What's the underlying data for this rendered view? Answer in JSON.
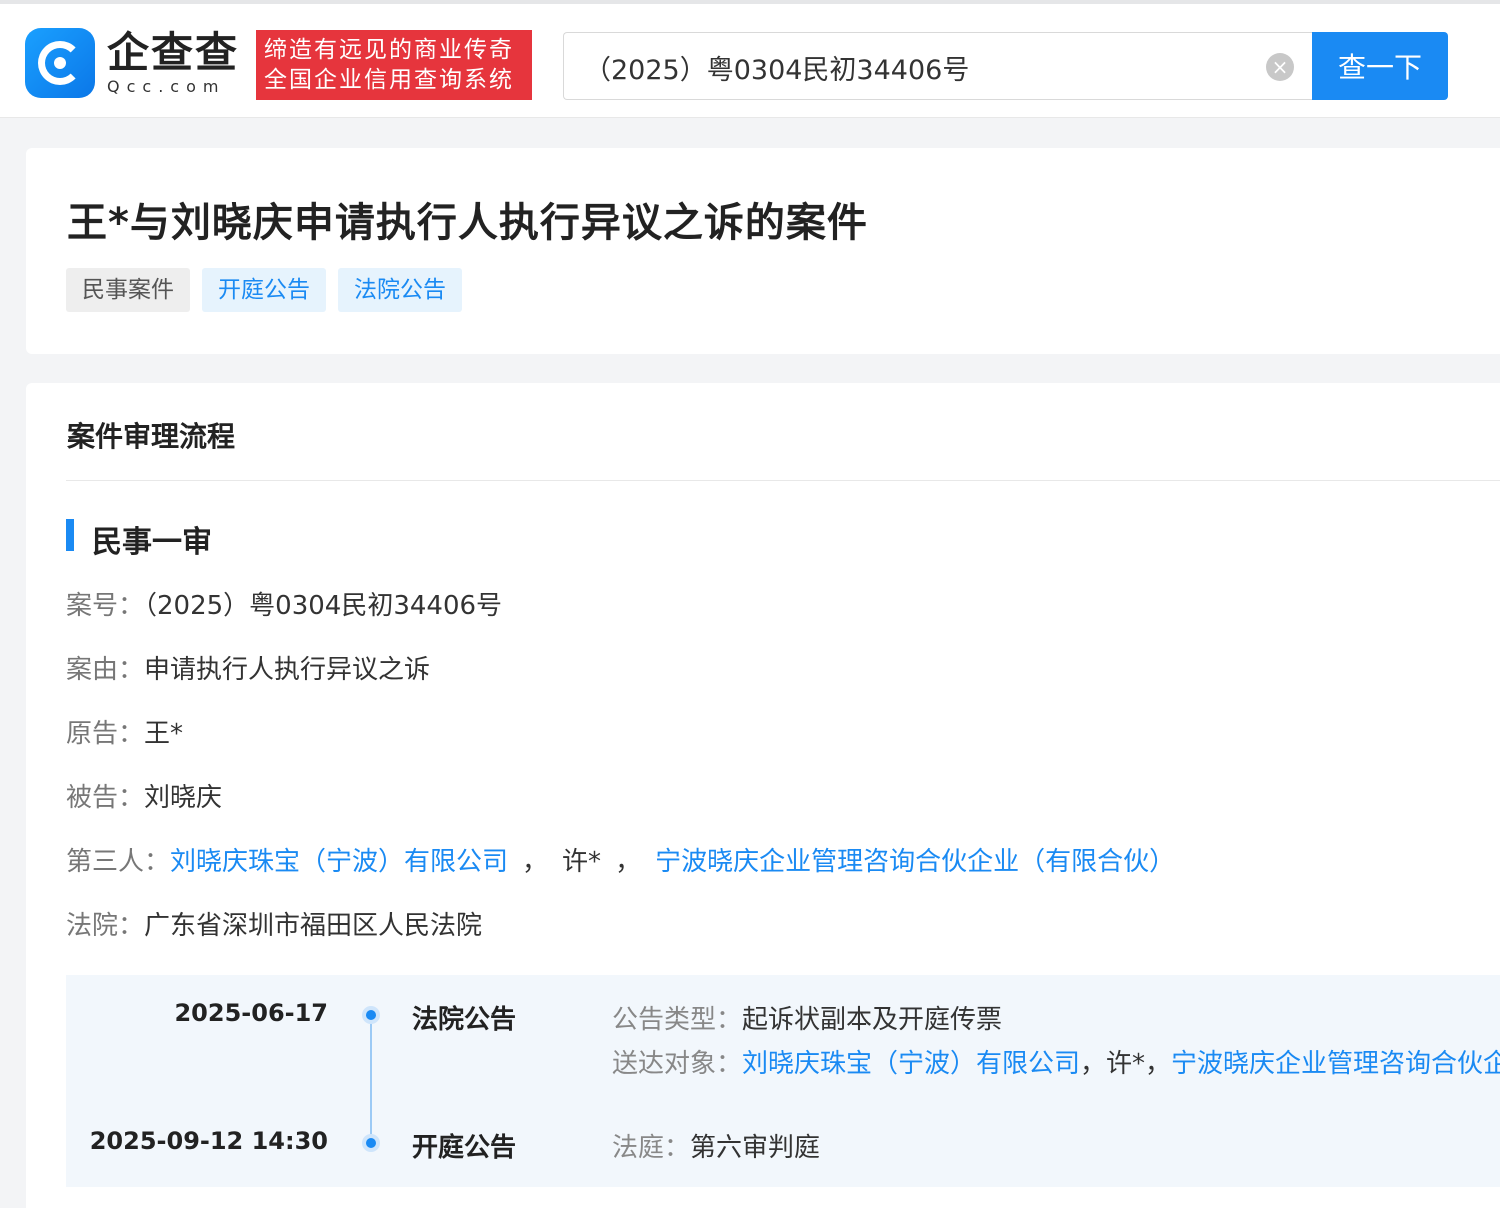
{
  "header": {
    "logo_name": "企查查",
    "logo_domain": "Qcc.com",
    "slogan_line1": "缔造有远见的商业传奇",
    "slogan_line2": "全国企业信用查询系统",
    "search_value": "（2025）粤0304民初34406号",
    "search_button": "查一下",
    "clear_icon": "×"
  },
  "case": {
    "title": "王*与刘晓庆申请执行人执行异议之诉的案件",
    "tags": [
      "民事案件",
      "开庭公告",
      "法院公告"
    ]
  },
  "process": {
    "section_title": "案件审理流程",
    "stage_title": "民事一审",
    "case_no_label": "案号：",
    "case_no": "（2025）粤0304民初34406号",
    "cause_label": "案由：",
    "cause": "申请执行人执行异议之诉",
    "plaintiff_label": "原告：",
    "plaintiff": "王*",
    "defendant_label": "被告：",
    "defendant": "刘晓庆",
    "third_label": "第三人：",
    "third_1": "刘晓庆珠宝（宁波）有限公司",
    "third_sep1": "，",
    "third_2": "许*",
    "third_sep2": "，",
    "third_3": "宁波晓庆企业管理咨询合伙企业（有限合伙）",
    "court_label": "法院：",
    "court": "广东省深圳市福田区人民法院"
  },
  "timeline": [
    {
      "date": "2025-06-17",
      "type": "法院公告",
      "info1_label": "公告类型：",
      "info1": "起诉状副本及开庭传票",
      "info2_label": "送达对象：",
      "info2_a": "刘晓庆珠宝（宁波）有限公司",
      "info2_sep": "，许*，",
      "info2_b": "宁波晓庆企业管理咨询合伙企业（有限合伙）"
    },
    {
      "date": "2025-09-12 14:30",
      "type": "开庭公告",
      "info1_label": "法庭：",
      "info1": "第六审判庭"
    }
  ]
}
